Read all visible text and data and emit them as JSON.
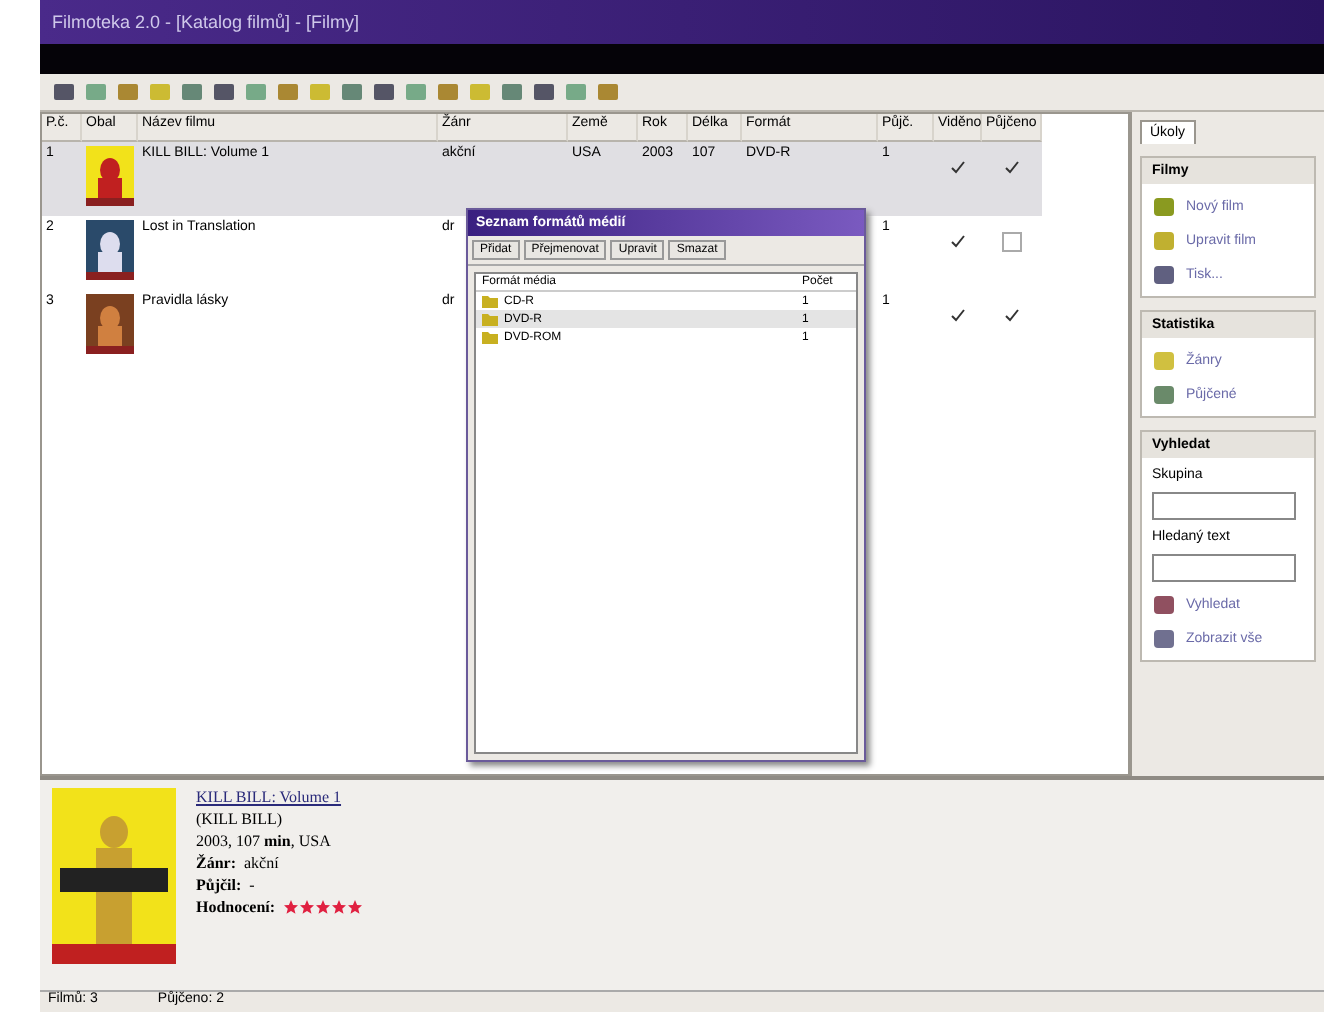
{
  "window": {
    "title": "Filmoteka 2.0 - [Katalog filmů] - [Filmy]"
  },
  "table": {
    "columns": [
      "P.č.",
      "Obal",
      "Název filmu",
      "Žánr",
      "Země",
      "Rok",
      "Délka",
      "Formát",
      "Půjč.",
      "Viděno",
      "Půjčeno"
    ],
    "rows": [
      {
        "cells": [
          "1",
          "",
          "KILL BILL: Volume 1",
          "akční",
          "USA",
          "2003",
          "107",
          "DVD-R",
          "1"
        ],
        "seen": true,
        "lent": true,
        "selected": true
      },
      {
        "cells": [
          "2",
          "",
          "Lost in Translation",
          "dr",
          null,
          null,
          null,
          null,
          "1"
        ],
        "seen": true,
        "lent": false,
        "selected": false
      },
      {
        "cells": [
          "3",
          "",
          "Pravidla lásky",
          "dr",
          null,
          null,
          null,
          null,
          "1"
        ],
        "seen": true,
        "lent": true,
        "selected": false
      }
    ]
  },
  "dialog": {
    "title": "Seznam formátů médií",
    "buttons": [
      "Přidat",
      "Přejmenovat",
      "Upravit",
      "Smazat"
    ],
    "columns": [
      "Formát média",
      "Počet"
    ],
    "items": [
      {
        "label": "CD-R",
        "count": "1",
        "selected": false
      },
      {
        "label": "DVD-R",
        "count": "1",
        "selected": true
      },
      {
        "label": "DVD-ROM",
        "count": "1",
        "selected": false
      }
    ]
  },
  "side_panel": {
    "tab": "Úkoly",
    "sections": [
      {
        "title": "Filmy",
        "items": [
          "Nový film",
          "Upravit film",
          "Tisk..."
        ]
      },
      {
        "title": "Statistika",
        "items": [
          "Žánry",
          "Půjčené"
        ]
      },
      {
        "title": "Vyhledat",
        "group_label": "Skupina",
        "text_label": "Hledaný text",
        "items": [
          "Vyhledat",
          "Zobrazit vše"
        ]
      }
    ]
  },
  "detail": {
    "title": "KILL BILL: Volume 1",
    "original_title": "(KILL BILL)",
    "info": "2003, 107 **min**, USA",
    "genre_label": "Žánr:",
    "genre": "akční",
    "lent_label": "Půjčil:",
    "lent": "-",
    "rating_label": "Hodnocení:",
    "stars": 5
  },
  "status_bar": [
    "Filmů: 3",
    "Půjčeno: 2"
  ]
}
